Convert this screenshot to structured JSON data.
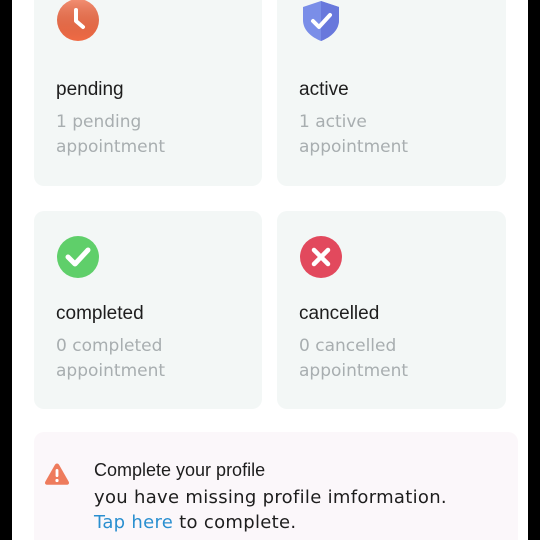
{
  "cards": [
    {
      "title": "pending",
      "count_line": "1 pending",
      "appointment_word": "appointment",
      "icon": "clock-icon",
      "color": "#f06b45"
    },
    {
      "title": "active",
      "count_line": "1 active",
      "appointment_word": "appointment",
      "icon": "shield-check-icon",
      "color": "#7a8ee8"
    },
    {
      "title": "completed",
      "count_line": "0 completed",
      "appointment_word": "appointment",
      "icon": "checkmark-icon",
      "color": "#5fcf6a"
    },
    {
      "title": "cancelled",
      "count_line": "0 cancelled",
      "appointment_word": "appointment",
      "icon": "close-icon",
      "color": "#e2495d"
    }
  ],
  "profile_banner": {
    "title": "Complete your profile",
    "message": "you have missing profile imformation.",
    "link_text": "Tap here",
    "suffix": " to complete.",
    "icon": "warning-icon",
    "icon_color": "#ee7b5c"
  }
}
